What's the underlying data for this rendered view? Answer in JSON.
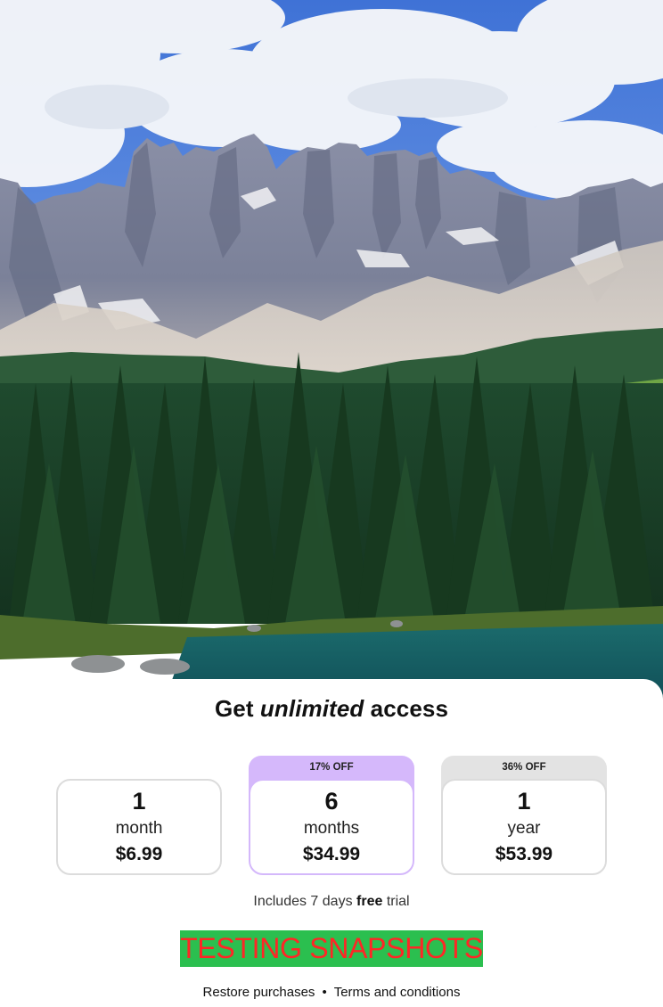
{
  "hero": {
    "image": "mountain-lake-forest-photo"
  },
  "headline": {
    "prefix": "Get ",
    "emphasis": "unlimited",
    "suffix": " access"
  },
  "plans": [
    {
      "badge": "",
      "qty": "1",
      "unit": "month",
      "price": "$6.99",
      "selected": false,
      "badge_color": ""
    },
    {
      "badge": "17% OFF",
      "qty": "6",
      "unit": "months",
      "price": "$34.99",
      "selected": true,
      "badge_color": "#d5b8fb"
    },
    {
      "badge": "36% OFF",
      "qty": "1",
      "unit": "year",
      "price": "$53.99",
      "selected": false,
      "badge_color": "#e3e3e3"
    }
  ],
  "trial": {
    "prefix": "Includes 7 days ",
    "bold": "free",
    "suffix": " trial"
  },
  "cta": {
    "label": "TESTING SNAPSHOTS"
  },
  "footer": {
    "restore": "Restore purchases",
    "separator": "•",
    "terms": "Terms and conditions"
  },
  "colors": {
    "accent": "#d5b8fb",
    "cta_bg": "#2bbf4f",
    "cta_text": "#ff2626"
  }
}
